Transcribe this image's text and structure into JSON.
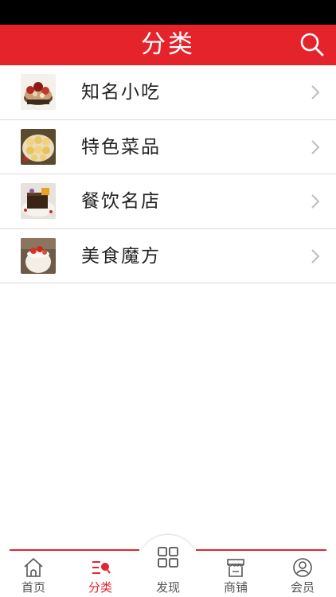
{
  "header": {
    "title": "分类",
    "search_icon": "search-icon"
  },
  "categories": [
    {
      "label": "知名小吃",
      "thumb": "food-photo-thumbnail"
    },
    {
      "label": "特色菜品",
      "thumb": "food-photo-thumbnail"
    },
    {
      "label": "餐饮名店",
      "thumb": "food-photo-thumbnail"
    },
    {
      "label": "美食魔方",
      "thumb": "food-photo-thumbnail"
    }
  ],
  "tabbar": {
    "items": [
      {
        "label": "首页",
        "icon": "home-icon",
        "active": false
      },
      {
        "label": "分类",
        "icon": "category-icon",
        "active": true
      },
      {
        "label": "发现",
        "icon": "grid-icon",
        "active": false
      },
      {
        "label": "商铺",
        "icon": "store-icon",
        "active": false
      },
      {
        "label": "会员",
        "icon": "user-icon",
        "active": false
      }
    ]
  },
  "colors": {
    "brand": "#e5232b",
    "text": "#222222",
    "muted": "#555555",
    "divider": "#dcdcdc"
  }
}
